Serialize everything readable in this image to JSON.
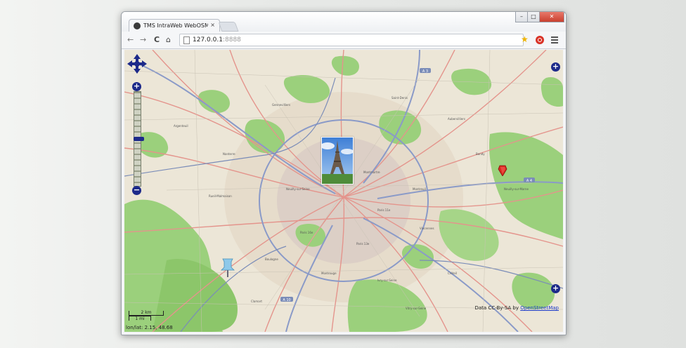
{
  "browser": {
    "tab_title": "TMS IntraWeb WebOSMap",
    "tab_close": "×",
    "url_host": "127.0.0.1",
    "url_port": ":8888",
    "window_controls": {
      "minimize": "–",
      "maximize": "□",
      "close": "✕"
    },
    "nav": {
      "back": "←",
      "forward": "→",
      "reload": "C",
      "home": "⌂"
    },
    "icons": [
      "back-icon",
      "forward-icon",
      "reload-icon",
      "home-icon",
      "page-icon",
      "bookmark-star-icon",
      "extension-icon",
      "menu-icon"
    ]
  },
  "map": {
    "zoom_in": "+",
    "zoom_out": "−",
    "layer_switcher": "+",
    "attribution_prefix": "Data CC-By-SA by ",
    "attribution_link": "OpenStreetMap",
    "scale_top": "2 km",
    "scale_bottom": "1 mi",
    "mouse_position": "lon/lat: 2.15, 48.68",
    "road_shields": [
      "A 3",
      "A 4",
      "A 10"
    ],
    "markers": [
      "eiffel-tower-photo-marker",
      "red-marker",
      "pushpin-marker"
    ],
    "colors": {
      "land": "#ece6d7",
      "park": "#9bd07c",
      "road": "#e4948c",
      "motorway": "#8a9ac8",
      "control": "#1d2a8a",
      "marker": "#d9281f"
    }
  }
}
